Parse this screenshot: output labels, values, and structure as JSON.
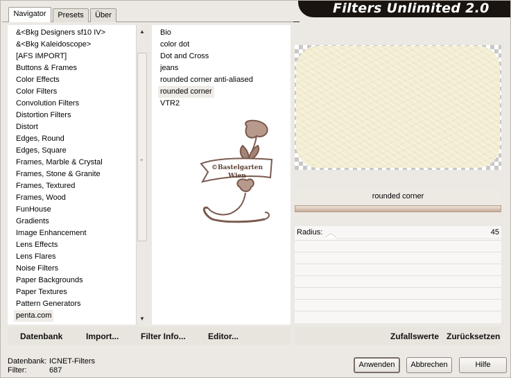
{
  "tabs": [
    {
      "label": "Navigator",
      "active": true
    },
    {
      "label": "Presets",
      "active": false
    },
    {
      "label": "Über",
      "active": false
    }
  ],
  "title": "Filters Unlimited 2.0",
  "categories": [
    "&<Bkg Designers sf10 IV>",
    "&<Bkg Kaleidoscope>",
    "[AFS IMPORT]",
    "Buttons & Frames",
    "Color Effects",
    "Color Filters",
    "Convolution Filters",
    "Distortion Filters",
    "Distort",
    "Edges, Round",
    "Edges, Square",
    "Frames, Marble & Crystal",
    "Frames, Stone & Granite",
    "Frames, Textured",
    "Frames, Wood",
    "FunHouse",
    "Gradients",
    "Image Enhancement",
    "Lens Effects",
    "Lens Flares",
    "Noise Filters",
    "Paper Backgrounds",
    "Paper Textures",
    "Pattern Generators",
    "penta.com"
  ],
  "selected_category": "penta.com",
  "filters": [
    "Bio",
    "color dot",
    "Dot and Cross",
    "jeans",
    "rounded corner anti-aliased",
    "rounded corner",
    "VTR2"
  ],
  "selected_filter": "rounded corner",
  "watermark": {
    "line1": "©Bastelgarten",
    "line2": "Wien"
  },
  "preview": {
    "filter_name": "rounded corner",
    "progress": 1.0
  },
  "params": [
    {
      "label": "Radius:",
      "value": "45"
    }
  ],
  "toolbar": {
    "database": "Datenbank",
    "import": "Import...",
    "filter_info": "Filter Info...",
    "editor": "Editor...",
    "random": "Zufallswerte",
    "reset": "Zurücksetzen"
  },
  "status": {
    "database_label": "Datenbank:",
    "database_value": "ICNET-Filters",
    "filter_label": "Filter:",
    "filter_value": "687"
  },
  "buttons": {
    "apply": "Anwenden",
    "cancel": "Abbrechen",
    "help": "Hilfe"
  },
  "colors": {
    "background": "#ece9e4",
    "banner": "#1a1410",
    "preview_fill": "#f2ecd0",
    "watermark": "#7a5a4e"
  }
}
